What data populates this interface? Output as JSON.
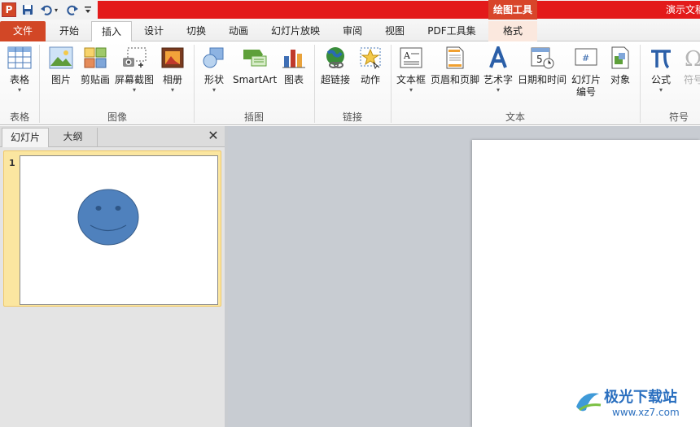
{
  "quick_access": {
    "app_icon_letter": "P"
  },
  "title_bar": {
    "context_tools_label": "绘图工具",
    "document_title": "演示文稿"
  },
  "tabs": {
    "file": "文件",
    "home": "开始",
    "insert": "插入",
    "design": "设计",
    "transitions": "切换",
    "animations": "动画",
    "slideshow": "幻灯片放映",
    "review": "审阅",
    "view": "视图",
    "pdf": "PDF工具集",
    "format": "格式"
  },
  "ribbon": {
    "table": "表格",
    "picture": "图片",
    "clipart": "剪贴画",
    "screenshot": "屏幕截图",
    "album": "相册",
    "shapes": "形状",
    "smartart": "SmartArt",
    "chart": "图表",
    "hyperlink": "超链接",
    "action": "动作",
    "textbox": "文本框",
    "header_footer": "页眉和页脚",
    "wordart": "艺术字",
    "datetime": "日期和时间",
    "slide_number_1": "幻灯片",
    "slide_number_2": "编号",
    "object": "对象",
    "equation": "公式",
    "symbol": "符号",
    "groups": {
      "tables": "表格",
      "images": "图像",
      "illustrations": "插图",
      "links": "链接",
      "text": "文本",
      "symbols": "符号"
    }
  },
  "panel": {
    "tab_slides": "幻灯片",
    "tab_outline": "大纲",
    "close": "✕",
    "slide_number": "1"
  },
  "watermark": {
    "brand": "极光下载站",
    "url": "www.xz7.com"
  },
  "colors": {
    "title_red": "#e31a1a",
    "file_tab": "#d24726",
    "smiley_fill": "#4f81bd",
    "smiley_stroke": "#385d8a"
  }
}
